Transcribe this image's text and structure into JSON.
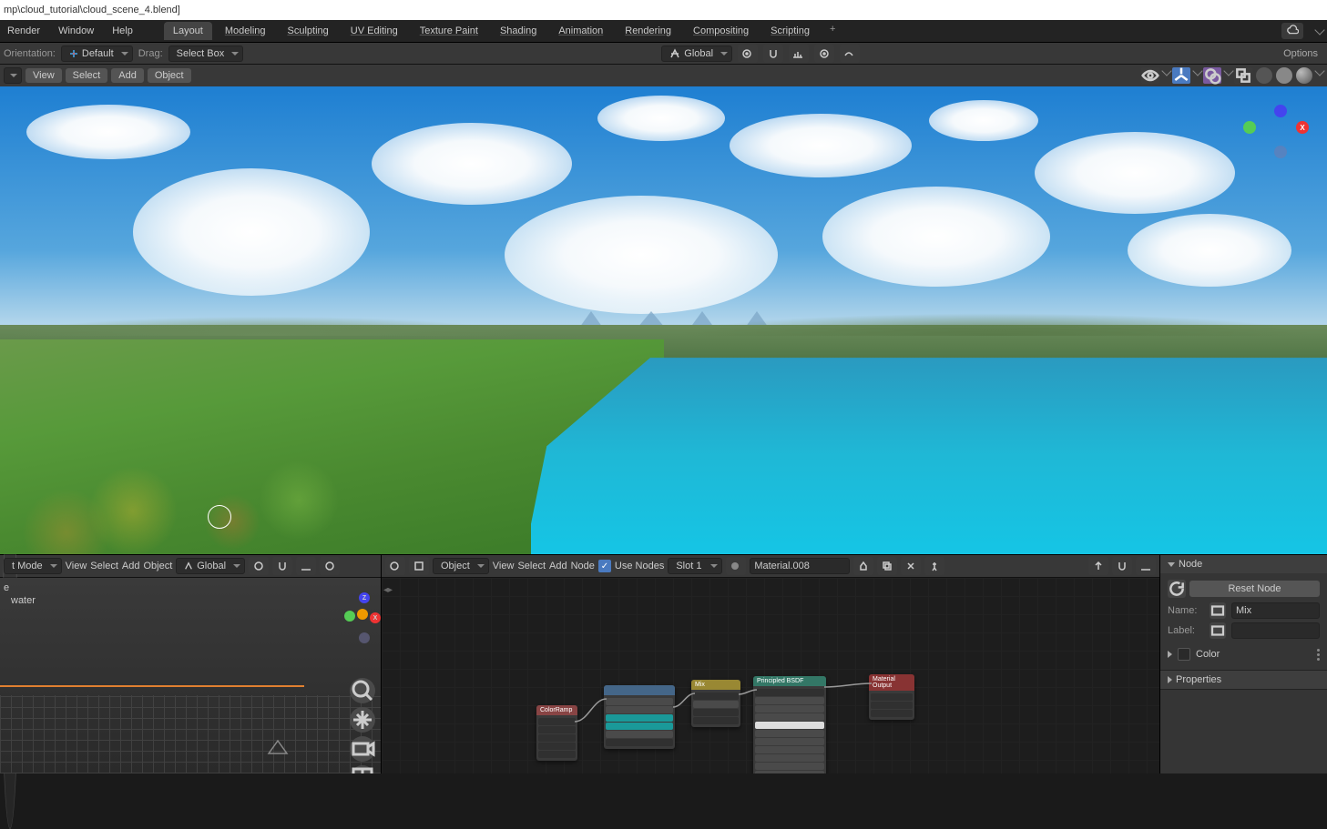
{
  "title_path": "mp\\cloud_tutorial\\cloud_scene_4.blend]",
  "menus": {
    "render": "Render",
    "window": "Window",
    "help": "Help"
  },
  "workspaces": [
    "Layout",
    "Modeling",
    "Sculpting",
    "UV Editing",
    "Texture Paint",
    "Shading",
    "Animation",
    "Rendering",
    "Compositing",
    "Scripting"
  ],
  "active_workspace": 0,
  "toolbar": {
    "orientation_label": "Orientation:",
    "orientation_value": "Default",
    "drag_label": "Drag:",
    "drag_value": "Select Box",
    "transform_space": "Global",
    "options": "Options"
  },
  "vp_header": {
    "view": "View",
    "select": "Select",
    "add": "Add",
    "object": "Object"
  },
  "bottom_left": {
    "mode": "t Mode",
    "view": "View",
    "select": "Select",
    "add": "Add",
    "object": "Object",
    "transform_space": "Global",
    "tree_items": [
      "e",
      "water"
    ]
  },
  "node_header": {
    "object": "Object",
    "view": "View",
    "select": "Select",
    "add": "Add",
    "node": "Node",
    "use_nodes": "Use Nodes",
    "slot": "Slot 1",
    "material": "Material.008"
  },
  "nodes": {
    "color_ramp": "ColorRamp",
    "mix": "Mix",
    "bsdf": "Principled BSDF",
    "output": "Material Output"
  },
  "sidebar": {
    "node": "Node",
    "reset": "Reset Node",
    "name_label": "Name:",
    "name_value": "Mix",
    "label_label": "Label:",
    "color": "Color",
    "properties": "Properties"
  }
}
